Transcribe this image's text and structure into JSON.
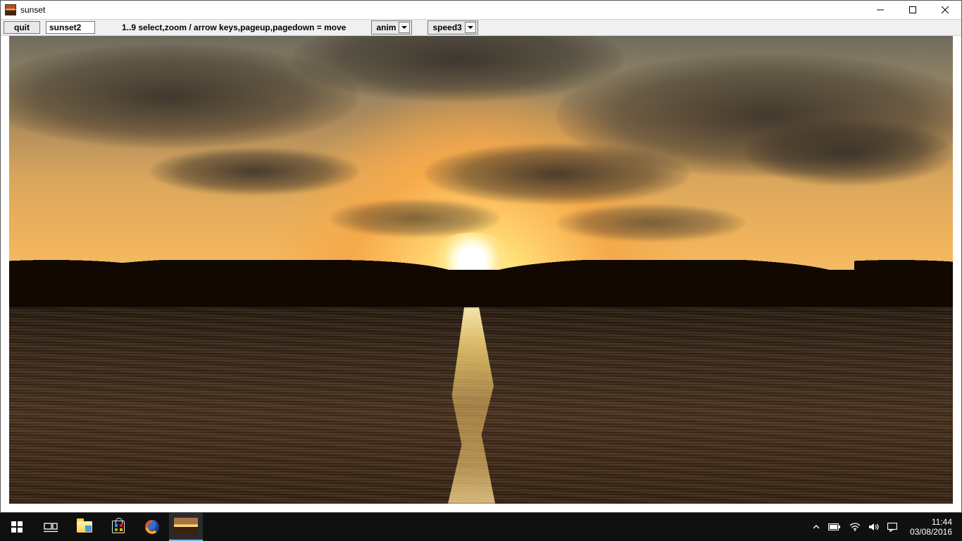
{
  "window": {
    "title": "sunset"
  },
  "toolbar": {
    "quit_label": "quit",
    "name_field_value": "sunset2",
    "help_text": "1..9 select,zoom / arrow keys,pageup,pagedown = move",
    "anim_combo": "anim",
    "speed_combo": "speed3"
  },
  "taskbar": {
    "time": "11:44",
    "date": "03/08/2016"
  }
}
